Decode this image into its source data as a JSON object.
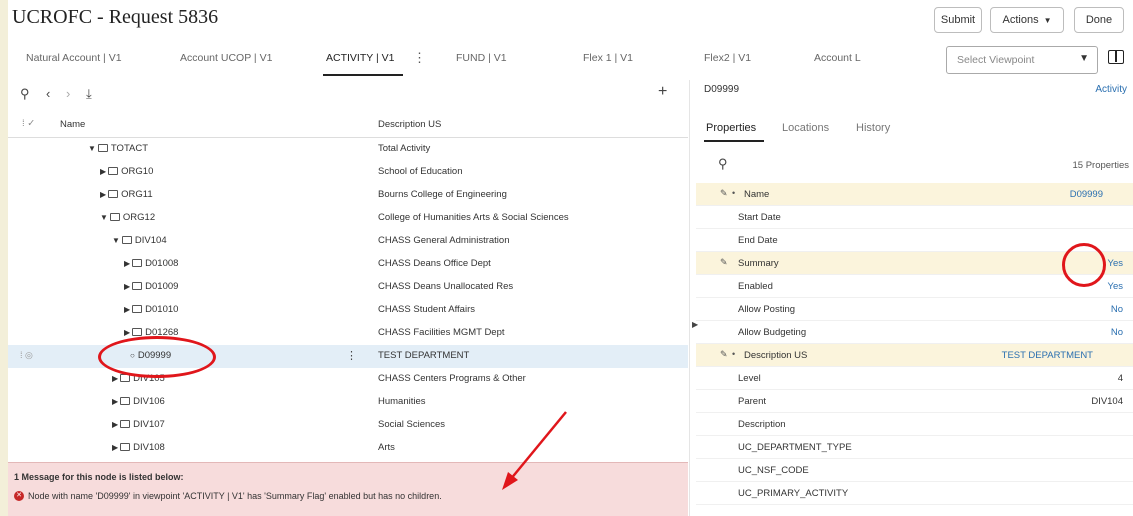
{
  "header": {
    "title": "UCROFC - Request 5836",
    "buttons": {
      "submit": "Submit",
      "actions": "Actions",
      "done": "Done"
    }
  },
  "tabs": [
    {
      "label": "Natural Account | V1"
    },
    {
      "label": "Account UCOP | V1"
    },
    {
      "label": "ACTIVITY | V1"
    },
    {
      "label": "FUND | V1"
    },
    {
      "label": "Flex 1 | V1"
    },
    {
      "label": "Flex2 | V1"
    },
    {
      "label": "Account L"
    }
  ],
  "viewpoint": {
    "placeholder": "Select Viewpoint"
  },
  "grid": {
    "columns": {
      "name": "Name",
      "description": "Description US"
    },
    "rows": [
      {
        "name": "TOTACT",
        "desc": "Total Activity"
      },
      {
        "name": "ORG10",
        "desc": "School of Education"
      },
      {
        "name": "ORG11",
        "desc": "Bourns College of Engineering"
      },
      {
        "name": "ORG12",
        "desc": "College of Humanities Arts & Social Sciences"
      },
      {
        "name": "DIV104",
        "desc": "CHASS General Administration"
      },
      {
        "name": "D01008",
        "desc": "CHASS Deans Office Dept"
      },
      {
        "name": "D01009",
        "desc": "CHASS Deans Unallocated Res"
      },
      {
        "name": "D01010",
        "desc": "CHASS Student Affairs"
      },
      {
        "name": "D01268",
        "desc": "CHASS Facilities MGMT Dept"
      },
      {
        "name": "D09999",
        "desc": "TEST DEPARTMENT"
      },
      {
        "name": "DIV105",
        "desc": "CHASS Centers Programs & Other"
      },
      {
        "name": "DIV106",
        "desc": "Humanities"
      },
      {
        "name": "DIV107",
        "desc": "Social Sciences"
      },
      {
        "name": "DIV108",
        "desc": "Arts"
      }
    ]
  },
  "message": {
    "title": "1 Message for this node is listed below:",
    "text": "Node with name 'D09999' in viewpoint 'ACTIVITY | V1' has 'Summary Flag' enabled but has no children."
  },
  "right_panel": {
    "node": "D09999",
    "link": "Activity",
    "tabs": {
      "properties": "Properties",
      "locations": "Locations",
      "history": "History"
    },
    "count": "15 Properties",
    "properties": [
      {
        "label": "Name",
        "value": "D09999"
      },
      {
        "label": "Start Date",
        "value": ""
      },
      {
        "label": "End Date",
        "value": ""
      },
      {
        "label": "Summary",
        "value": "Yes"
      },
      {
        "label": "Enabled",
        "value": "Yes"
      },
      {
        "label": "Allow Posting",
        "value": "No"
      },
      {
        "label": "Allow Budgeting",
        "value": "No"
      },
      {
        "label": "Description US",
        "value": "TEST DEPARTMENT"
      },
      {
        "label": "Level",
        "value": "4"
      },
      {
        "label": "Parent",
        "value": "DIV104"
      },
      {
        "label": "Description",
        "value": ""
      },
      {
        "label": "UC_DEPARTMENT_TYPE",
        "value": ""
      },
      {
        "label": "UC_NSF_CODE",
        "value": ""
      },
      {
        "label": "UC_PRIMARY_ACTIVITY",
        "value": ""
      }
    ]
  },
  "colors": {
    "annotation": "#e0161b",
    "link": "#2a6fb0",
    "error_bg": "#f7dcdc",
    "highlight_row": "#fbf4dc",
    "selected_row": "#e3eef7"
  }
}
